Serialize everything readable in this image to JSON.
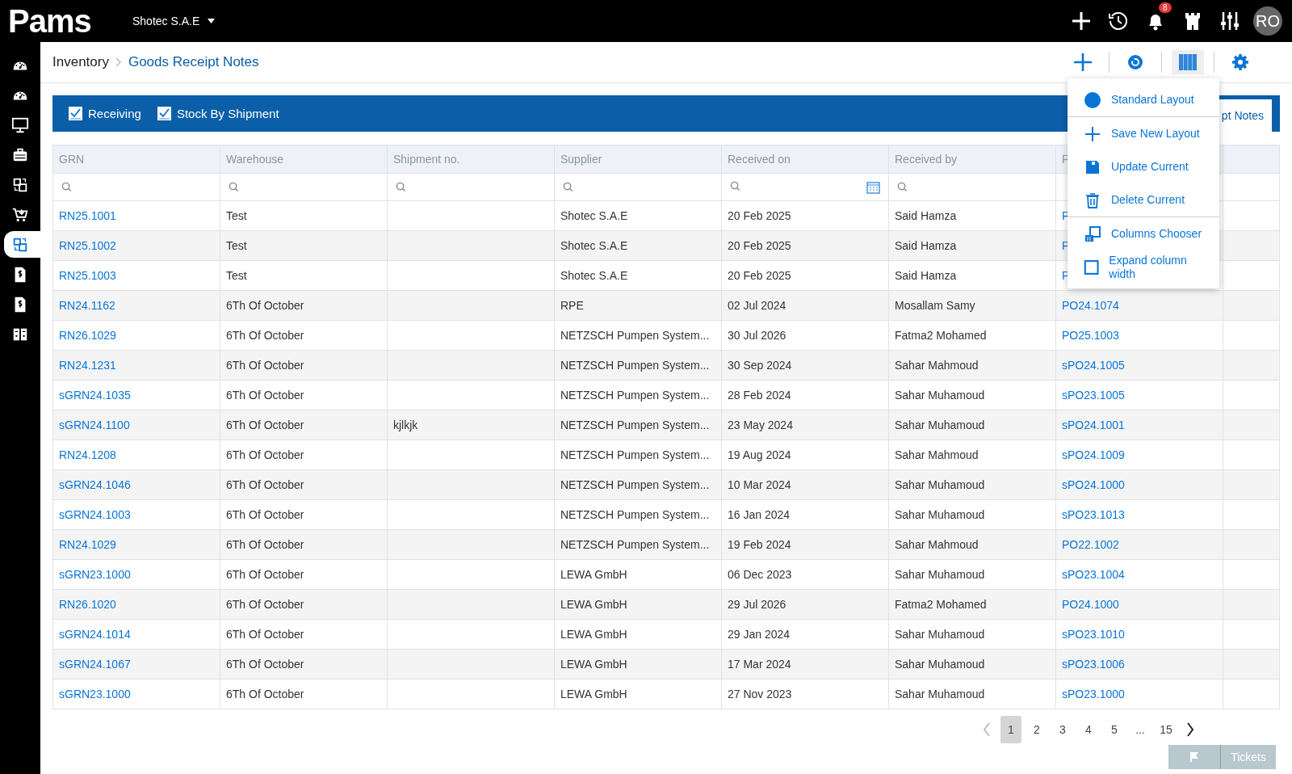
{
  "topbar": {
    "logo": "Pams",
    "company": "Shotec S.A.E",
    "notifications": "8",
    "avatar": "RO"
  },
  "sidebar": {
    "items": [
      {
        "selected": false
      },
      {
        "selected": false
      },
      {
        "selected": false
      },
      {
        "selected": false
      },
      {
        "selected": false
      },
      {
        "selected": false
      },
      {
        "selected": true
      },
      {
        "selected": false
      },
      {
        "selected": false
      },
      {
        "selected": false
      }
    ]
  },
  "breadcrumb": {
    "parent": "Inventory",
    "current": "Goods Receipt Notes"
  },
  "filters": [
    {
      "label": "Receiving",
      "checked": true
    },
    {
      "label": "Stock By Shipment",
      "checked": true
    }
  ],
  "tab": {
    "label": "pt Notes",
    "selected": true
  },
  "layout_menu": {
    "items": [
      {
        "kind": "circle",
        "label": "Standard Layout"
      },
      {
        "kind": "plus",
        "label": "Save New Layout"
      },
      {
        "kind": "save",
        "label": "Update Current"
      },
      {
        "kind": "trash",
        "label": "Delete Current"
      },
      {
        "kind": "columns",
        "label": "Columns Chooser"
      },
      {
        "kind": "square",
        "label": "Expand column width"
      }
    ]
  },
  "table": {
    "columns": [
      "GRN",
      "Warehouse",
      "Shipment no.",
      "Supplier",
      "Received on",
      "Received by",
      "P"
    ],
    "rows": [
      [
        "RN25.1001",
        "Test",
        "",
        "Shotec S.A.E",
        "20 Feb 2025",
        "Said Hamza",
        "P"
      ],
      [
        "RN25.1002",
        "Test",
        "",
        "Shotec S.A.E",
        "20 Feb 2025",
        "Said Hamza",
        "P"
      ],
      [
        "RN25.1003",
        "Test",
        "",
        "Shotec S.A.E",
        "20 Feb 2025",
        "Said Hamza",
        "P"
      ],
      [
        "RN24.1162",
        "6Th Of October",
        "",
        "RPE",
        "02 Jul 2024",
        "Mosallam Samy",
        "PO24.1074"
      ],
      [
        "RN26.1029",
        "6Th Of October",
        "",
        "NETZSCH Pumpen System...",
        "30 Jul 2026",
        "Fatma2 Mohamed",
        "PO25.1003"
      ],
      [
        "RN24.1231",
        "6Th Of October",
        "",
        "NETZSCH Pumpen System...",
        "30 Sep 2024",
        "Sahar Mahmoud",
        "sPO24.1005"
      ],
      [
        "sGRN24.1035",
        "6Th Of October",
        "",
        "NETZSCH Pumpen System...",
        "28 Feb 2024",
        "Sahar Muhamoud",
        "sPO23.1005"
      ],
      [
        "sGRN24.1100",
        "6Th Of October",
        "kjlkjk",
        "NETZSCH Pumpen System...",
        "23 May 2024",
        "Sahar Muhamoud",
        "sPO24.1001"
      ],
      [
        "RN24.1208",
        "6Th Of October",
        "",
        "NETZSCH Pumpen System...",
        "19 Aug 2024",
        "Sahar Mahmoud",
        "sPO24.1009"
      ],
      [
        "sGRN24.1046",
        "6Th Of October",
        "",
        "NETZSCH Pumpen System...",
        "10 Mar 2024",
        "Sahar Muhamoud",
        "sPO24.1000"
      ],
      [
        "sGRN24.1003",
        "6Th Of October",
        "",
        "NETZSCH Pumpen System...",
        "16 Jan 2024",
        "Sahar Muhamoud",
        "sPO23.1013"
      ],
      [
        "RN24.1029",
        "6Th Of October",
        "",
        "NETZSCH Pumpen System...",
        "19 Feb 2024",
        "Sahar Mahmoud",
        "PO22.1002"
      ],
      [
        "sGRN23.1000",
        "6Th Of October",
        "",
        "LEWA GmbH",
        "06 Dec 2023",
        "Sahar Muhamoud",
        "sPO23.1004"
      ],
      [
        "RN26.1020",
        "6Th Of October",
        "",
        "LEWA GmbH",
        "29 Jul 2026",
        "Fatma2 Mohamed",
        "PO24.1000"
      ],
      [
        "sGRN24.1014",
        "6Th Of October",
        "",
        "LEWA GmbH",
        "29 Jan 2024",
        "Sahar Muhamoud",
        "sPO23.1010"
      ],
      [
        "sGRN24.1067",
        "6Th Of October",
        "",
        "LEWA GmbH",
        "17 Mar 2024",
        "Sahar Muhamoud",
        "sPO23.1006"
      ],
      [
        "sGRN23.1000",
        "6Th Of October",
        "",
        "LEWA GmbH",
        "27 Nov 2023",
        "Sahar Muhamoud",
        "sPO23.1000"
      ]
    ]
  },
  "pagination": {
    "pages": [
      {
        "label": "1",
        "selected": true
      },
      {
        "label": "2",
        "selected": false
      },
      {
        "label": "3",
        "selected": false
      },
      {
        "label": "4",
        "selected": false
      },
      {
        "label": "5",
        "selected": false
      },
      {
        "label": "...",
        "selected": false
      },
      {
        "label": "15",
        "selected": false
      }
    ],
    "prev_disabled": true
  },
  "tickets": "Tickets"
}
